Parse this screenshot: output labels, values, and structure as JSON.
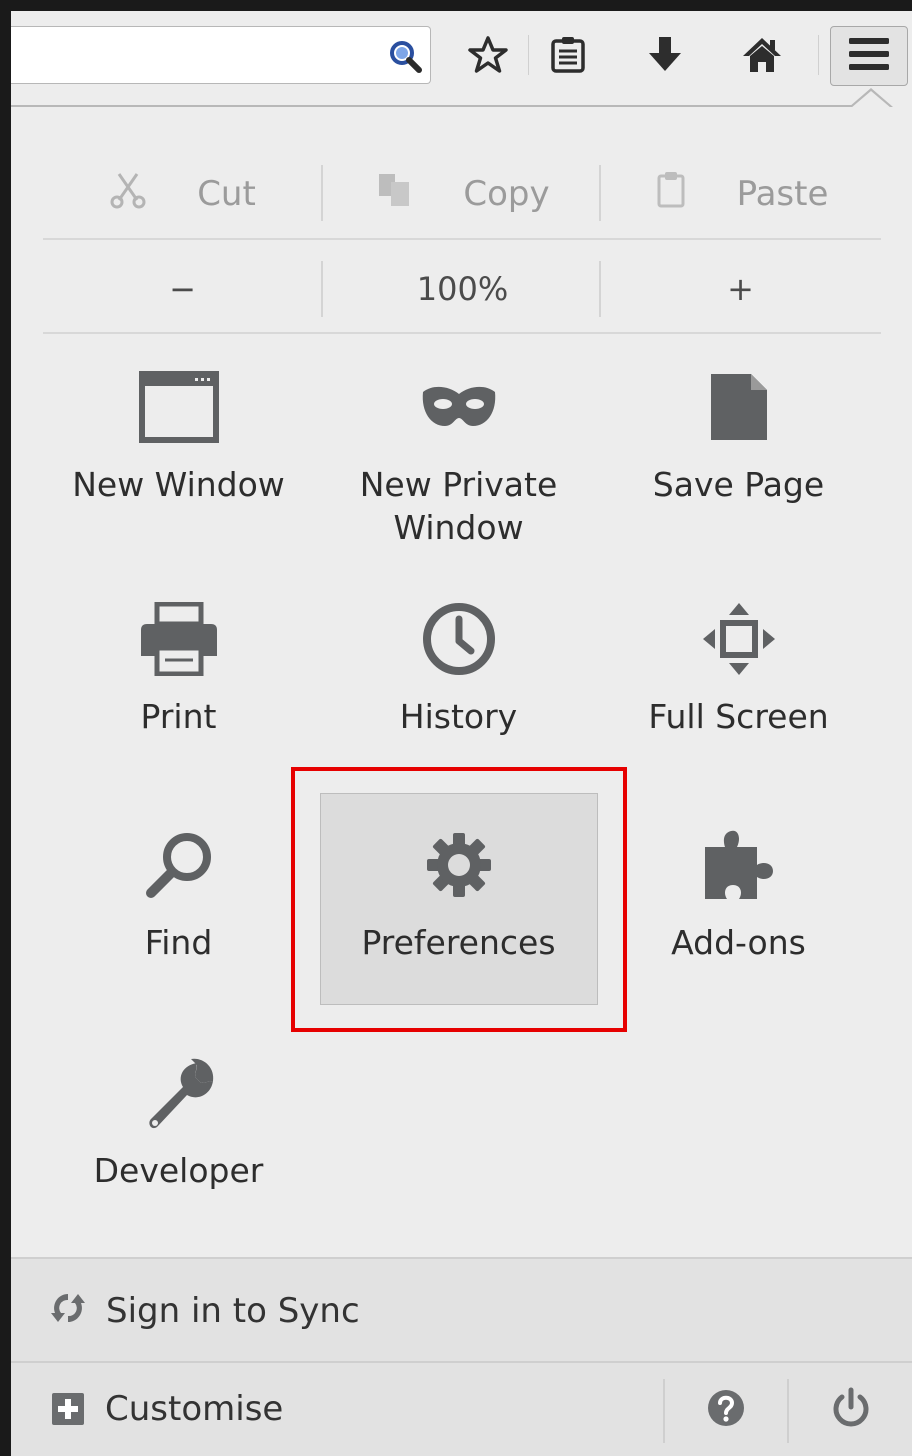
{
  "toolbar": {
    "search_placeholder": "",
    "icons": [
      "search-icon",
      "bookmark-star-icon",
      "reading-list-icon",
      "download-icon",
      "home-icon",
      "hamburger-menu-icon"
    ]
  },
  "edit": {
    "cut_label": "Cut",
    "copy_label": "Copy",
    "paste_label": "Paste"
  },
  "zoom": {
    "minus_label": "−",
    "level": "100%",
    "plus_label": "+"
  },
  "grid": {
    "new_window": "New Window",
    "new_private_window_line1": "New Private",
    "new_private_window_line2": "Window",
    "save_page": "Save Page",
    "print": "Print",
    "history": "History",
    "full_screen": "Full Screen",
    "find": "Find",
    "preferences": "Preferences",
    "addons": "Add-ons",
    "developer": "Developer"
  },
  "footer": {
    "sync_label": "Sign in to Sync",
    "customise_label": "Customise"
  },
  "colors": {
    "panel_bg": "#ededed",
    "icon_gray": "#5f6163",
    "highlight": "#e60000",
    "search_blue": "#2a56b8"
  }
}
